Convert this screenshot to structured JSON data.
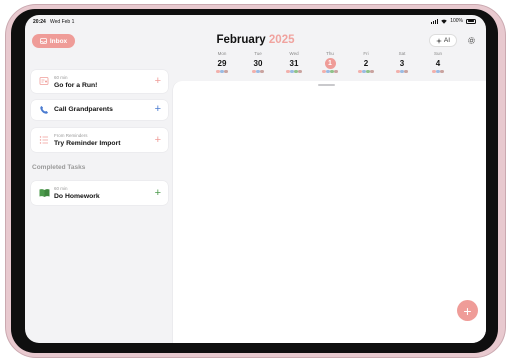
{
  "status": {
    "time": "20:24",
    "date": "Wed Feb 1",
    "battery": "100%"
  },
  "header": {
    "inbox_label": "Inbox",
    "month": "February",
    "year": "2025",
    "ai_label": "AI"
  },
  "week": [
    {
      "weekday": "Mon",
      "date": "29",
      "today": false,
      "dots": [
        "#f2b0ac",
        "#9bbbe3",
        "#c9a3a0"
      ]
    },
    {
      "weekday": "Tue",
      "date": "30",
      "today": false,
      "dots": [
        "#f2b0ac",
        "#9bbbe3",
        "#c9a3a0"
      ]
    },
    {
      "weekday": "Wed",
      "date": "31",
      "today": false,
      "dots": [
        "#f2b0ac",
        "#9bbbe3",
        "#8fc28a",
        "#c9a3a0"
      ]
    },
    {
      "weekday": "Thu",
      "date": "1",
      "today": true,
      "dots": [
        "#f2b0ac",
        "#9bbbe3",
        "#8fc28a",
        "#c9a3a0"
      ]
    },
    {
      "weekday": "Fri",
      "date": "2",
      "today": false,
      "dots": [
        "#f2b0ac",
        "#9bbbe3",
        "#8fc28a",
        "#c9a3a0"
      ]
    },
    {
      "weekday": "Sat",
      "date": "3",
      "today": false,
      "dots": [
        "#f2b0ac",
        "#9bbbe3",
        "#c9a3a0"
      ]
    },
    {
      "weekday": "Sun",
      "date": "4",
      "today": false,
      "dots": [
        "#f2b0ac",
        "#9bbbe3",
        "#c9a3a0"
      ]
    }
  ],
  "tasks": [
    {
      "subtitle": "60 min",
      "title": "Go for a Run!",
      "icon": "run-icon",
      "accent": "#ef9c98"
    },
    {
      "subtitle": "",
      "title": "Call Grandparents",
      "icon": "phone-icon",
      "accent": "#4a7bd0"
    },
    {
      "subtitle": "From Reminders",
      "title": "Try Reminder Import",
      "icon": "list-icon",
      "accent": "#ef9c98"
    }
  ],
  "completed": {
    "label": "Completed Tasks",
    "tasks": [
      {
        "subtitle": "60 min",
        "title": "Do Homework",
        "icon": "book-icon",
        "accent": "#4b9a4b"
      }
    ]
  },
  "colors": {
    "accent": "#ef9c98",
    "background": "#f3f3f5"
  }
}
